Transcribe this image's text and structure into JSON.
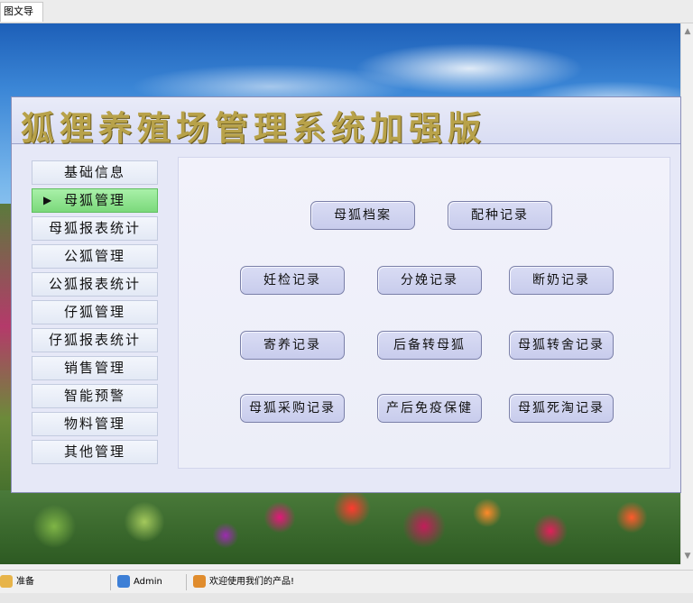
{
  "tab": {
    "label": "图文导航"
  },
  "app": {
    "title": "狐狸养殖场管理系统加强版"
  },
  "sidebar": {
    "items": [
      {
        "label": "基础信息"
      },
      {
        "label": "母狐管理",
        "active": true
      },
      {
        "label": "母狐报表统计"
      },
      {
        "label": "公狐管理"
      },
      {
        "label": "公狐报表统计"
      },
      {
        "label": "仔狐管理"
      },
      {
        "label": "仔狐报表统计"
      },
      {
        "label": "销售管理"
      },
      {
        "label": "智能预警"
      },
      {
        "label": "物料管理"
      },
      {
        "label": "其他管理"
      }
    ]
  },
  "buttons": {
    "b1": "母狐档案",
    "b2": "配种记录",
    "b3": "妊检记录",
    "b4": "分娩记录",
    "b5": "断奶记录",
    "b6": "寄养记录",
    "b7": "后备转母狐",
    "b8": "母狐转舍记录",
    "b9": "母狐采购记录",
    "b10": "产后免疫保健",
    "b11": "母狐死淘记录"
  },
  "status": {
    "ready": "准备",
    "user": "Admin",
    "welcome": "欢迎使用我们的产品!"
  },
  "icons": {
    "ready": "user-icon",
    "user": "user-avatar-icon",
    "welcome": "user-group-icon"
  },
  "colors": {
    "title_gold": "#b8a24a",
    "active_green": "#7bd97b",
    "panel_bg": "#e6e8f7"
  }
}
